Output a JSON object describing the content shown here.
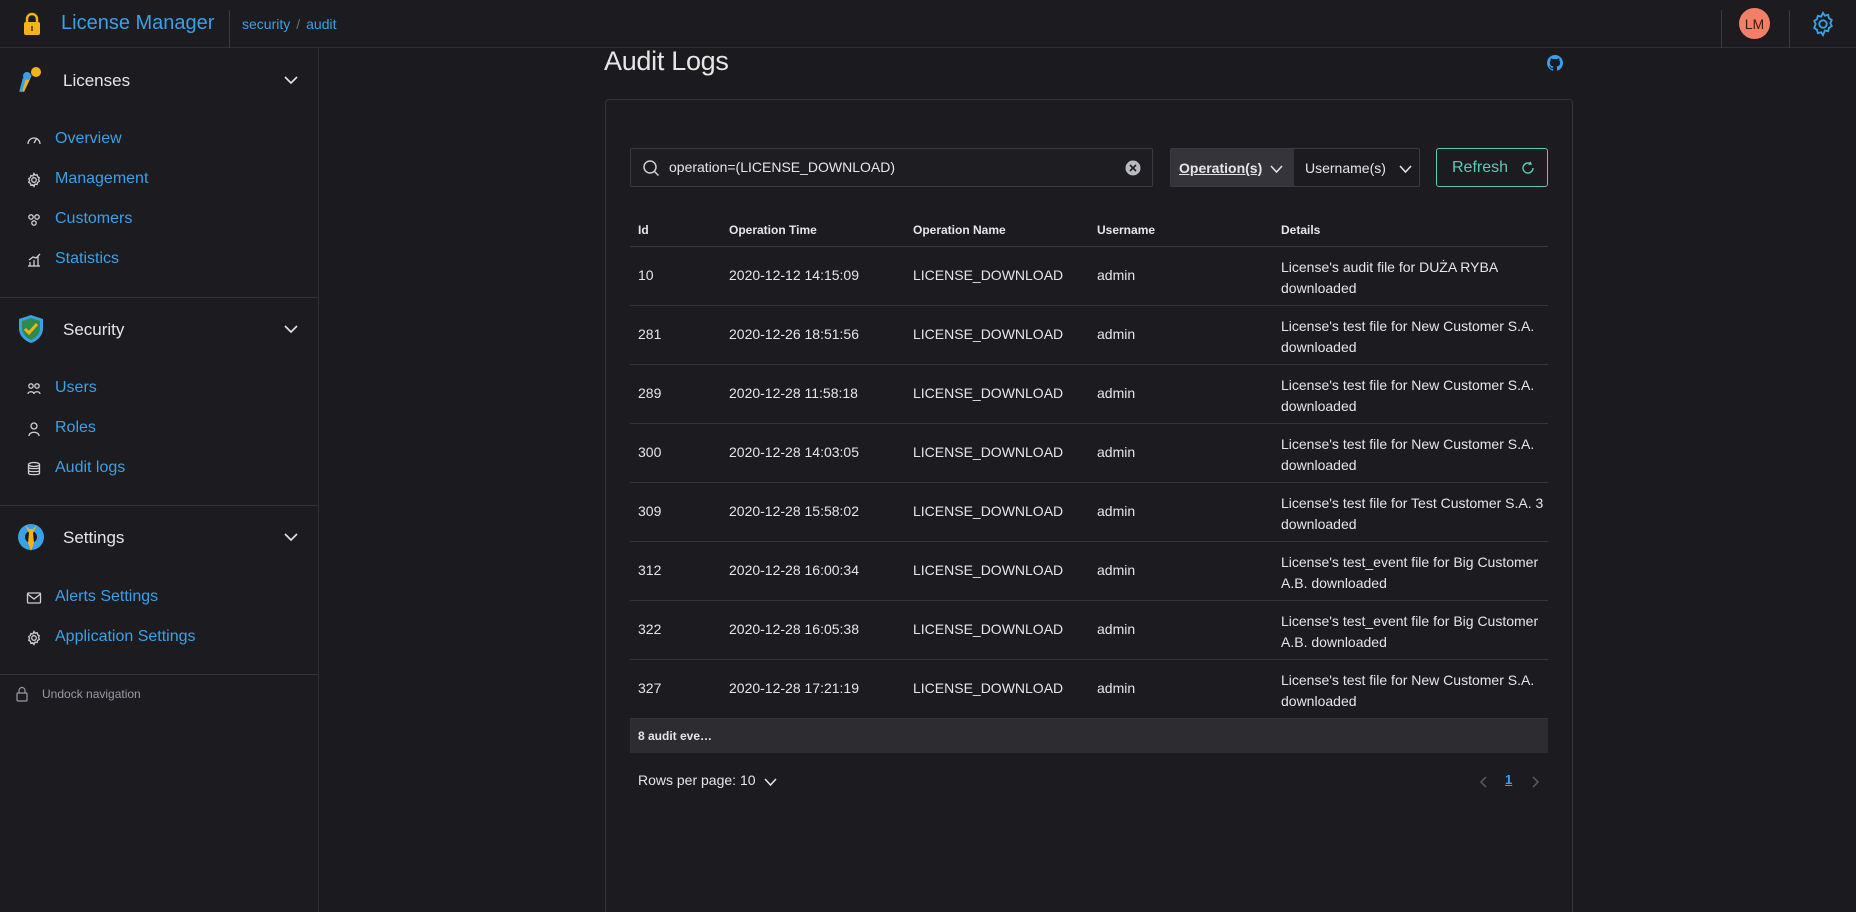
{
  "app": {
    "title": "License Manager",
    "avatar_initials": "LM",
    "accent": "#3aa0e8"
  },
  "breadcrumb": [
    "security",
    "audit"
  ],
  "sidebar": {
    "groups": [
      {
        "label": "Licenses",
        "icon": "keys-icon",
        "items": [
          {
            "label": "Overview",
            "icon": "gauge-icon"
          },
          {
            "label": "Management",
            "icon": "gear-icon"
          },
          {
            "label": "Customers",
            "icon": "customers-icon"
          },
          {
            "label": "Statistics",
            "icon": "chart-icon"
          }
        ]
      },
      {
        "label": "Security",
        "icon": "shield-icon",
        "items": [
          {
            "label": "Users",
            "icon": "users-icon"
          },
          {
            "label": "Roles",
            "icon": "role-icon"
          },
          {
            "label": "Audit logs",
            "icon": "database-icon"
          }
        ]
      },
      {
        "label": "Settings",
        "icon": "settings-wrench-icon",
        "items": [
          {
            "label": "Alerts Settings",
            "icon": "mail-icon"
          },
          {
            "label": "Application Settings",
            "icon": "gear-icon"
          }
        ]
      }
    ],
    "undock_label": "Undock navigation"
  },
  "main": {
    "title": "Audit Logs",
    "search": {
      "value": "operation=(LICENSE_DOWNLOAD)"
    },
    "filters": {
      "operations_label": "Operation(s)",
      "usernames_label": "Username(s)"
    },
    "refresh_label": "Refresh",
    "table": {
      "columns": [
        "Id",
        "Operation Time",
        "Operation Name",
        "Username",
        "Details"
      ],
      "rows": [
        {
          "id": "10",
          "time": "2020-12-12 14:15:09",
          "op": "LICENSE_DOWNLOAD",
          "user": "admin",
          "details": "License's audit file for DUŻA RYBA downloaded"
        },
        {
          "id": "281",
          "time": "2020-12-26 18:51:56",
          "op": "LICENSE_DOWNLOAD",
          "user": "admin",
          "details": "License's test file for New Customer S.A. downloaded"
        },
        {
          "id": "289",
          "time": "2020-12-28 11:58:18",
          "op": "LICENSE_DOWNLOAD",
          "user": "admin",
          "details": "License's test file for New Customer S.A. downloaded"
        },
        {
          "id": "300",
          "time": "2020-12-28 14:03:05",
          "op": "LICENSE_DOWNLOAD",
          "user": "admin",
          "details": "License's test file for New Customer S.A. downloaded"
        },
        {
          "id": "309",
          "time": "2020-12-28 15:58:02",
          "op": "LICENSE_DOWNLOAD",
          "user": "admin",
          "details": "License's test file for Test Customer S.A. 3 downloaded"
        },
        {
          "id": "312",
          "time": "2020-12-28 16:00:34",
          "op": "LICENSE_DOWNLOAD",
          "user": "admin",
          "details": "License's test_event file for Big Customer A.B. downloaded"
        },
        {
          "id": "322",
          "time": "2020-12-28 16:05:38",
          "op": "LICENSE_DOWNLOAD",
          "user": "admin",
          "details": "License's test_event file for Big Customer A.B. downloaded"
        },
        {
          "id": "327",
          "time": "2020-12-28 17:21:19",
          "op": "LICENSE_DOWNLOAD",
          "user": "admin",
          "details": "License's test file for New Customer S.A. downloaded"
        }
      ],
      "footer": "8 audit eve…"
    },
    "pagination": {
      "rows_per_page_label": "Rows per page: 10",
      "current_page": "1"
    }
  }
}
